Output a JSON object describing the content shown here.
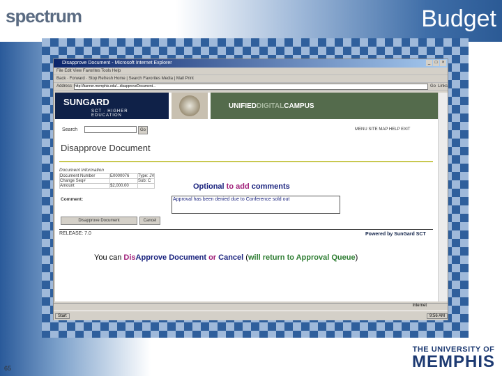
{
  "slide": {
    "logo": "spectrum",
    "title": "Budget",
    "page_number": "65",
    "university_line1": "THE UNIVERSITY OF",
    "university_line2": "MEMPHIS"
  },
  "browser": {
    "title": "Disapprove Document - Microsoft Internet Explorer",
    "menu": "File  Edit  View  Favorites  Tools  Help",
    "toolbar": "Back  ·  Forward  ·  Stop  Refresh  Home  |  Search  Favorites  Media  |  Mail  Print",
    "address_label": "Address",
    "address_value": "http://banner.memphis.edu/...disapproveDocument...",
    "go": "Go",
    "links": "Links",
    "status": "Internet"
  },
  "banner": {
    "brand": "SUNGARD",
    "sub": "SCT · HIGHER EDUCATION",
    "udc_1": "UNIFIED",
    "udc_2": "DIGITAL",
    "udc_3": "CAMPUS"
  },
  "page": {
    "search_label": "Search",
    "go": "Go",
    "nav": "MENU  SITE MAP  HELP  EXIT",
    "heading": "Disapprove Document",
    "doc_info": "Document Information",
    "rows": [
      [
        "Document Number",
        "E0000076",
        "Type: JV"
      ],
      [
        "Change Seq#",
        "",
        "Sub: C"
      ],
      [
        "Amount",
        "$2,000.00",
        ""
      ]
    ],
    "comment_label": "Comment:",
    "comment_value": "Approval has been denied due to Conference sold out",
    "disapprove_btn": "Disapprove Document",
    "cancel_btn": "Cancel",
    "release": "RELEASE: 7.0",
    "powered": "Powered by SunGard SCT"
  },
  "annotations": {
    "opt_a": "Optional",
    "opt_b": "to add",
    "opt_c": "comments",
    "bottom_a": "You can ",
    "bottom_b": "Dis",
    "bottom_c": "Approve Document",
    "bottom_d": " or ",
    "bottom_e": "Cancel",
    "bottom_f": " (",
    "bottom_g": "will return to Approval Queue",
    "bottom_h": ")"
  },
  "taskbar": {
    "start": "Start",
    "clock": "9:56 AM"
  }
}
